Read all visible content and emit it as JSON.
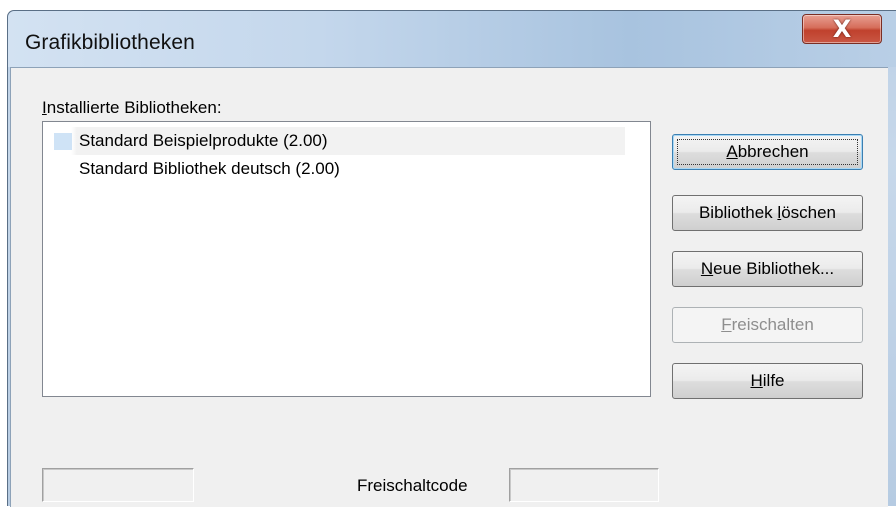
{
  "window": {
    "title": "Grafikbibliotheken",
    "close_glyph": "X"
  },
  "list": {
    "label_accel": "I",
    "label_rest": "nstallierte Bibliotheken:",
    "items": [
      {
        "label": "Standard Beispielprodukte (2.00)",
        "selected": true
      },
      {
        "label": "Standard Bibliothek deutsch (2.00)",
        "selected": false
      }
    ]
  },
  "buttons": {
    "cancel": {
      "accel": "A",
      "rest": "bbrechen",
      "default": true
    },
    "delete": {
      "before": "Bibliothek ",
      "accel": "l",
      "rest": "öschen"
    },
    "new": {
      "accel": "N",
      "rest": "eue Bibliothek..."
    },
    "unlock": {
      "accel": "F",
      "rest": "reischalten",
      "enabled": false
    },
    "help": {
      "accel": "H",
      "rest": "ilfe"
    }
  },
  "footer": {
    "status_value": "",
    "code_label": "Freischaltcode",
    "code_value": ""
  },
  "colors": {
    "selection_marker": "#cfe3f6",
    "close_button": "#c0412d",
    "dialog_background": "#f0f0f0"
  },
  "icons": {
    "close": "close-icon"
  }
}
